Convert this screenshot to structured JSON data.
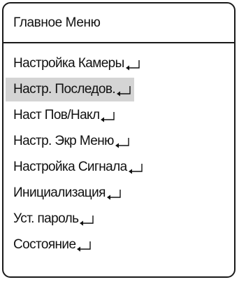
{
  "menu": {
    "title": "Главное Меню",
    "enter_icon": "enter-return-icon",
    "items": [
      {
        "label": "Настройка Камеры",
        "selected": false
      },
      {
        "label": "Настр. Последов.",
        "selected": true
      },
      {
        "label": "Наст Пов/Накл",
        "selected": false
      },
      {
        "label": "Настр. Экр Меню",
        "selected": false
      },
      {
        "label": "Настройка Сигнала",
        "selected": false
      },
      {
        "label": "Инициализация",
        "selected": false
      },
      {
        "label": "Уст. пароль",
        "selected": false
      },
      {
        "label": "Состояние",
        "selected": false
      }
    ]
  }
}
